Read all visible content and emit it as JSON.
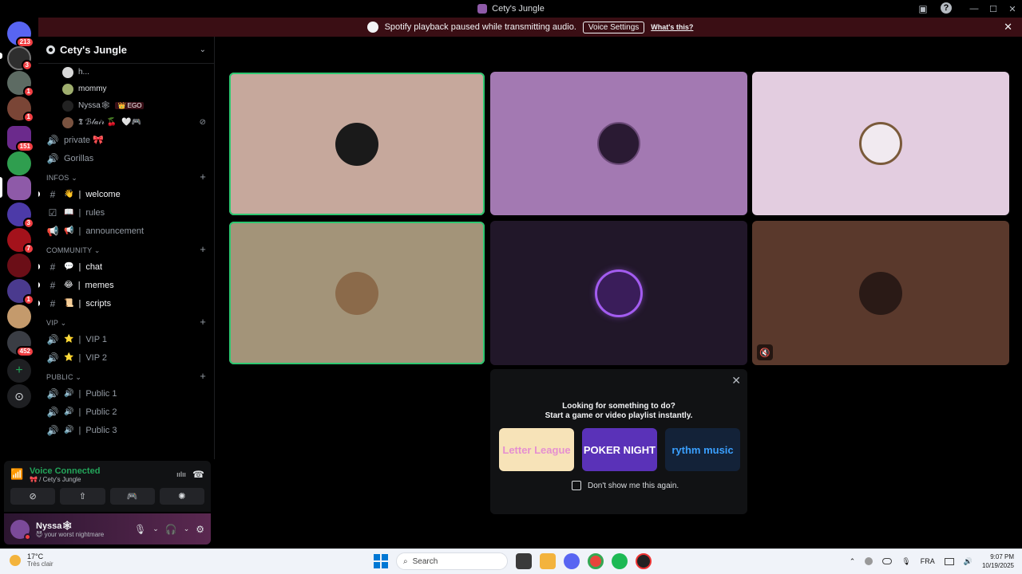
{
  "window": {
    "title": "Cety's Jungle",
    "minimize_icon": "—",
    "maximize_icon": "☐",
    "close_icon": "✕",
    "inbox_icon": "▣",
    "help_icon": "?"
  },
  "rail": {
    "badges": [
      "213",
      "3",
      "1",
      "1",
      "151",
      "3",
      "7",
      "1",
      "452"
    ],
    "add_icon": "+",
    "discover_icon": "⊙"
  },
  "banner": {
    "message": "Spotify playback paused while transmitting audio.",
    "button": "Voice Settings",
    "link": "What's this?",
    "close_icon": "✕"
  },
  "server": {
    "name": "Cety's Jungle",
    "dropdown_icon": "⌄"
  },
  "voice_users": [
    {
      "name": "h...",
      "tag": ""
    },
    {
      "name": "mommy",
      "tag": ""
    },
    {
      "name": "Nyssa🕸",
      "tag": "👑 EGO"
    },
    {
      "name": "𝕿 ℬ𝓁𝒶𝒾𝓇 🍒",
      "tag": "🤍🎮"
    }
  ],
  "voice_user_mute_icon": "⊘",
  "channels_top": [
    {
      "name": "private 🎀",
      "icon": "🔊"
    },
    {
      "name": "Gorillas",
      "icon": "🔊"
    }
  ],
  "categories": {
    "infos": "INFOS",
    "community": "COMMUNITY",
    "vip": "VIP",
    "public": "PUBLIC",
    "chevron": "⌄",
    "plus": "+"
  },
  "infos_channels": [
    {
      "icon": "#",
      "emoji": "👋",
      "name": "welcome"
    },
    {
      "icon": "☑",
      "emoji": "📖",
      "name": "rules"
    },
    {
      "icon": "📢",
      "emoji": "📢",
      "name": "announcement"
    }
  ],
  "community_channels": [
    {
      "icon": "#",
      "emoji": "💬",
      "name": "chat"
    },
    {
      "icon": "#",
      "emoji": "😂",
      "name": "memes"
    },
    {
      "icon": "#",
      "emoji": "📜",
      "name": "scripts"
    }
  ],
  "vip_channels": [
    {
      "icon": "🔊",
      "emoji": "⭐",
      "name": "VIP 1"
    },
    {
      "icon": "🔊",
      "emoji": "⭐",
      "name": "VIP 2"
    }
  ],
  "public_channels": [
    {
      "icon": "🔊",
      "emoji": "🔊",
      "name": "Public 1"
    },
    {
      "icon": "🔊",
      "emoji": "🔊",
      "name": "Public 2"
    },
    {
      "icon": "🔊",
      "emoji": "🔊",
      "name": "Public 3"
    }
  ],
  "voice_panel": {
    "title": "Voice Connected",
    "subtitle": "🎀 / Cety's Jungle",
    "signal_icon": "📶",
    "noise_icon": "ıılıı",
    "disconnect_icon": "☎",
    "buttons": [
      {
        "name": "camera",
        "icon": "⊘"
      },
      {
        "name": "screen-share",
        "icon": "⇧"
      },
      {
        "name": "activity",
        "icon": "🎮"
      },
      {
        "name": "soundboard",
        "icon": "✺"
      }
    ]
  },
  "user": {
    "name": "Nyssa🕸",
    "status": "😈 your worst nightmare",
    "mic_icon": "🎙",
    "headphones_icon": "🎧",
    "settings_icon": "⚙",
    "dropdown_icon": "⌄"
  },
  "tiles_mute_icon": "🔇",
  "popup": {
    "close_icon": "✕",
    "question1": "Looking for something to do?",
    "question2": "Start a game or video playlist instantly.",
    "activities": [
      "Letter League",
      "POKER NIGHT",
      "rythm music"
    ],
    "dont_show": "Don't show me this again."
  },
  "taskbar": {
    "temp": "17°C",
    "weather": "Très clair",
    "search_placeholder": "Search",
    "search_icon": "⌕",
    "tray_up_icon": "⌃",
    "tray_mic_icon": "🎙",
    "tray_lang": "FRA",
    "tray_speaker_icon": "🔊",
    "time": "9:07 PM",
    "date": "10/19/2025"
  }
}
